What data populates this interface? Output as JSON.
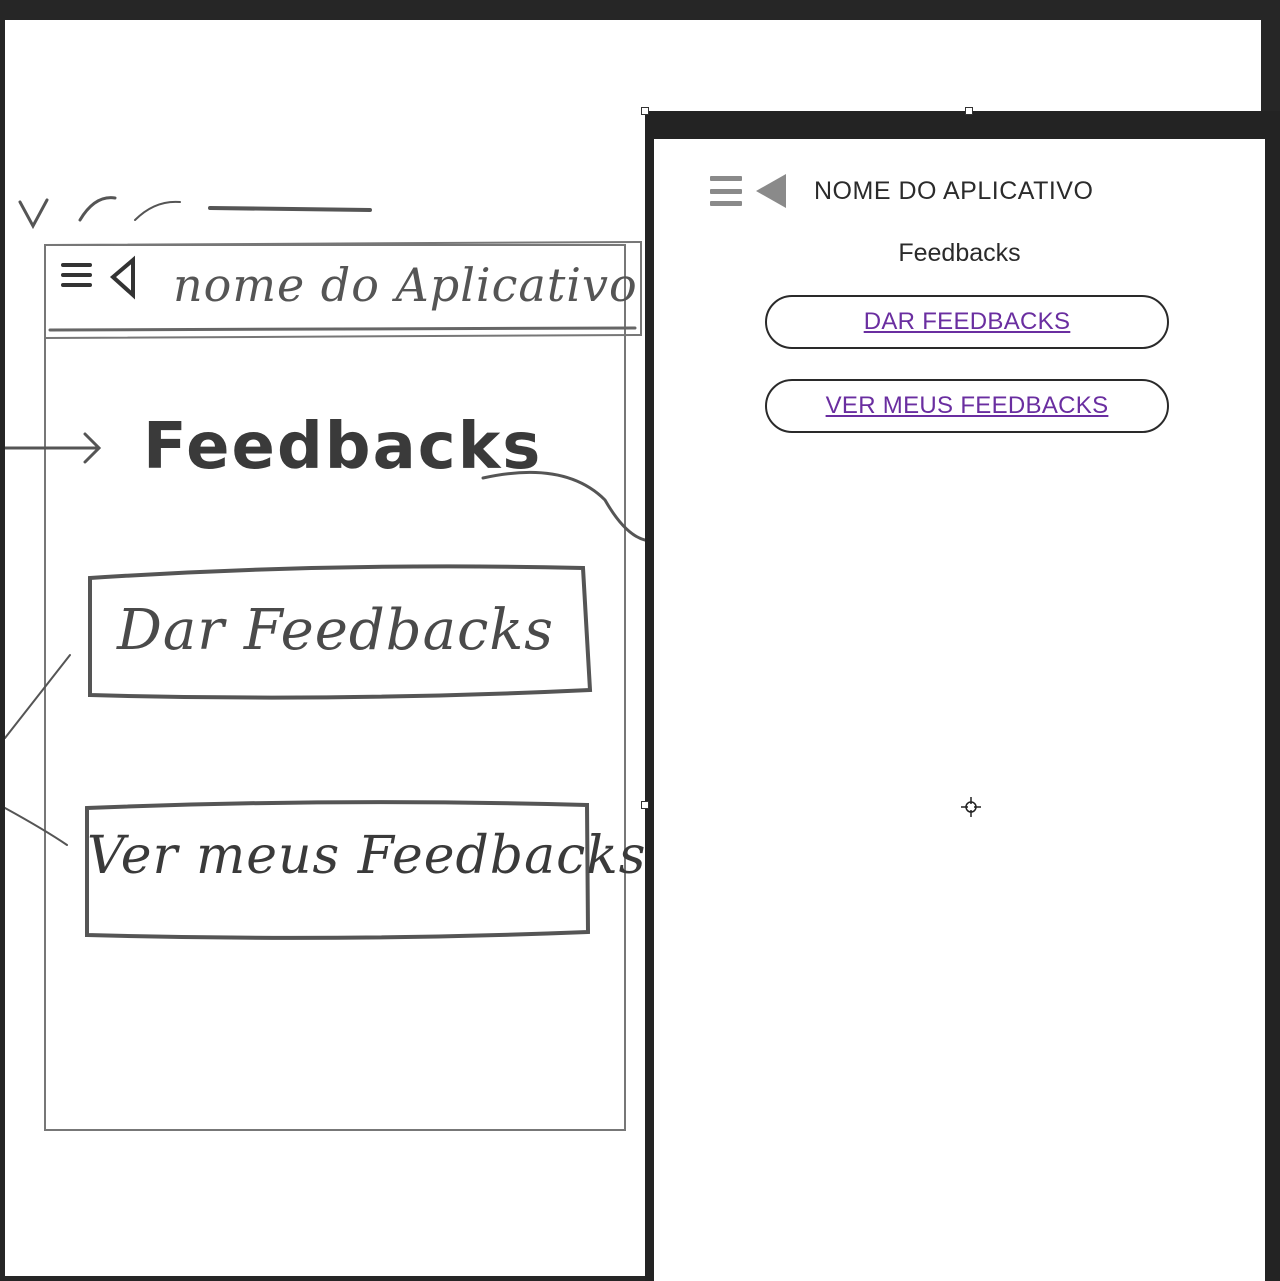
{
  "sketch": {
    "app_name": "nome do Aplicativo",
    "title": "Feedbacks",
    "button_give": "Dar Feedbacks",
    "button_view": "Ver meus Feedbacks"
  },
  "mockup": {
    "app_title": "NOME DO APLICATIVO",
    "page_title": "Feedbacks",
    "button_give": "DAR FEEDBACKS",
    "button_view": "VER MEUS FEEDBACKS",
    "menu_icon": "hamburger-menu-icon",
    "back_icon": "back-triangle-icon",
    "link_color": "#6a2ea0"
  }
}
